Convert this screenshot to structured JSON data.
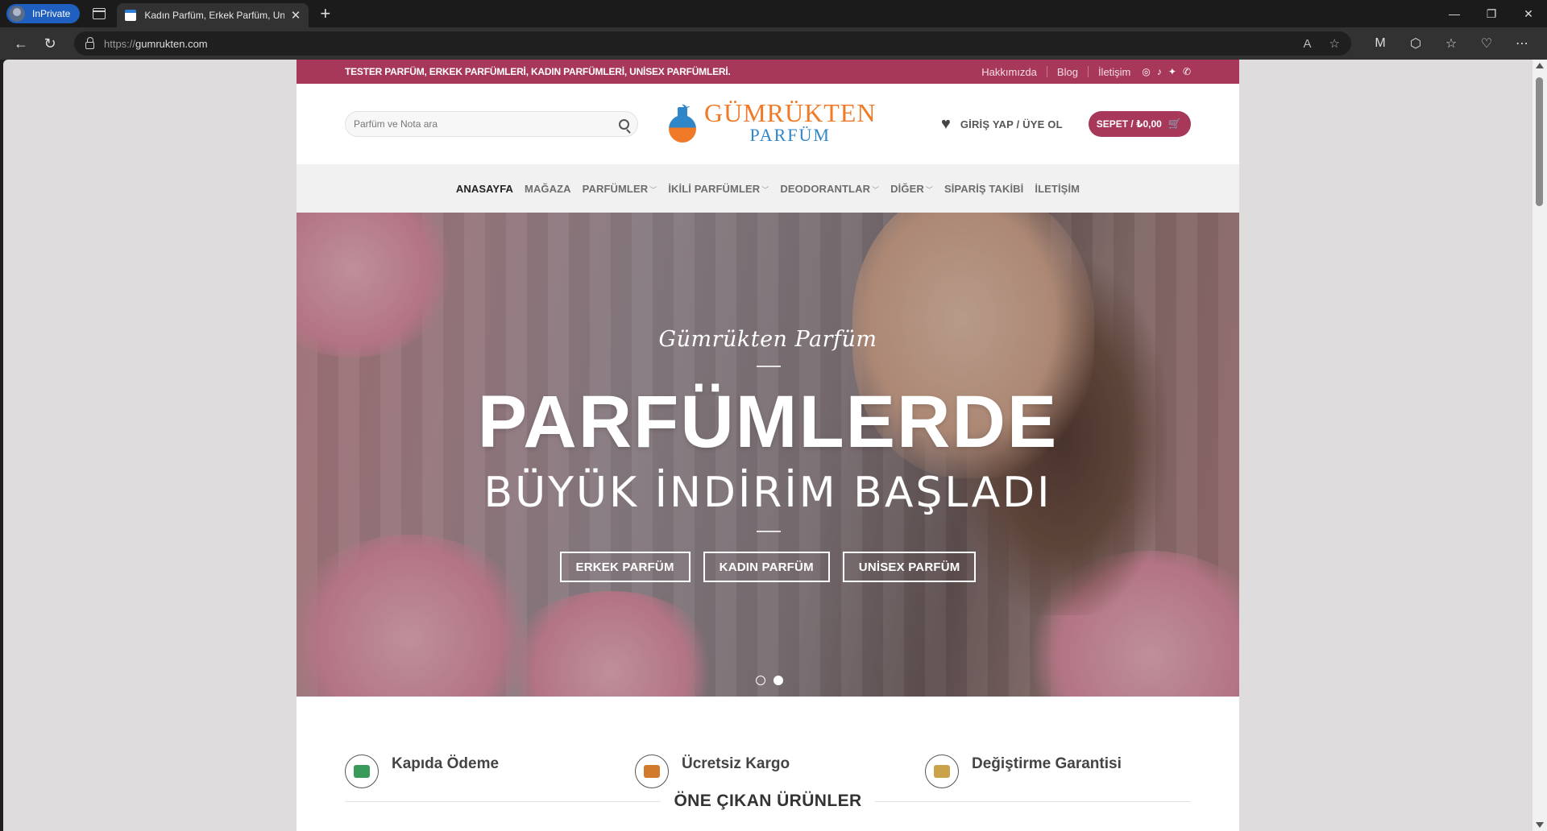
{
  "browser": {
    "profile_label": "InPrivate",
    "tab_title": "Kadın Parfüm, Erkek Parfüm, Unisex",
    "url_proto": "https://",
    "url_host": "gumrukten.com"
  },
  "site": {
    "topbar": {
      "promo": "TESTER PARFÜM, ERKEK PARFÜMLERİ, KADIN PARFÜMLERİ, UNİSEX PARFÜMLERİ.",
      "links": [
        "Hakkımızda",
        "Blog",
        "İletişim"
      ],
      "social_icons": [
        "instagram-icon",
        "tiktok-icon",
        "twitter-icon",
        "phone-icon"
      ]
    },
    "header": {
      "search_placeholder": "Parfüm ve Nota ara",
      "logo_line1": "GÜMRÜKTEN",
      "logo_line2": "PARFÜM",
      "login_label": "GİRİŞ YAP / ÜYE OL",
      "cart_label": "SEPET / ₺0,00"
    },
    "nav": {
      "items": [
        {
          "label": "ANASAYFA",
          "dropdown": false
        },
        {
          "label": "MAĞAZA",
          "dropdown": false
        },
        {
          "label": "PARFÜMLER",
          "dropdown": true
        },
        {
          "label": "İKİLİ PARFÜMLER",
          "dropdown": true
        },
        {
          "label": "DEODORANTLAR",
          "dropdown": true
        },
        {
          "label": "DİĞER",
          "dropdown": true
        },
        {
          "label": "SİPARİŞ TAKİBİ",
          "dropdown": false
        },
        {
          "label": "İLETİŞİM",
          "dropdown": false
        }
      ]
    },
    "hero": {
      "script_text": "Gümrükten Parfüm",
      "headline": "PARFÜMLERDE",
      "subheadline": "BÜYÜK İNDİRİM BAŞLADI",
      "buttons": [
        "ERKEK PARFÜM",
        "KADIN PARFÜM",
        "UNİSEX PARFÜM"
      ],
      "slide_count": 2,
      "active_slide": 2
    },
    "features": [
      {
        "label": "Kapıda Ödeme",
        "icon": "cash-hand-icon"
      },
      {
        "label": "Ücretsiz Kargo",
        "icon": "cargo-truck-icon"
      },
      {
        "label": "Değiştirme Garantisi",
        "icon": "exchange-box-icon"
      }
    ],
    "section_title": "ÖNE ÇIKAN ÜRÜNLER",
    "colors": {
      "brand": "#a8385a",
      "logo_orange": "#f07a28",
      "logo_blue": "#2f86c9"
    }
  }
}
